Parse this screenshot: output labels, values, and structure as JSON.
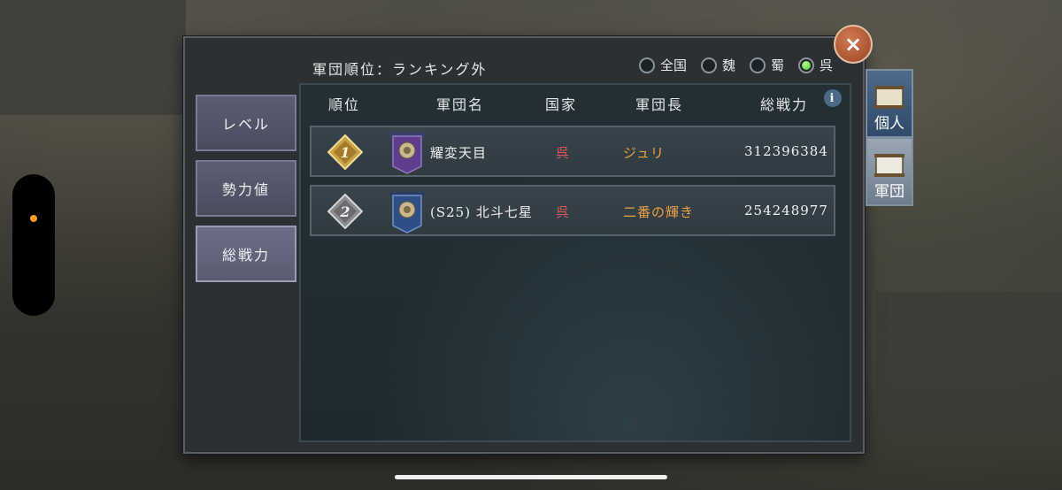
{
  "header": {
    "ranking_status": "軍団順位：ランキング外",
    "filters": [
      {
        "label": "全国",
        "selected": false
      },
      {
        "label": "魏",
        "selected": false
      },
      {
        "label": "蜀",
        "selected": false
      },
      {
        "label": "呉",
        "selected": true
      }
    ]
  },
  "left_tabs": [
    {
      "label": "レベル",
      "active": false
    },
    {
      "label": "勢力値",
      "active": false
    },
    {
      "label": "総戦力",
      "active": true
    }
  ],
  "table": {
    "columns": [
      "順位",
      "軍団名",
      "国家",
      "軍団長",
      "総戦力"
    ],
    "rows": [
      {
        "rank": "1",
        "name": "耀変天目",
        "country": "呉",
        "leader": "ジュリ",
        "power": "312396384"
      },
      {
        "rank": "2",
        "name": "(S25) 北斗七星",
        "country": "呉",
        "leader": "二番の輝き",
        "power": "254248977"
      }
    ]
  },
  "right_tabs": [
    {
      "label": "個人"
    },
    {
      "label": "軍団"
    }
  ],
  "info_label": "i",
  "close_label": "×",
  "colors": {
    "country_wu": "#e0565a",
    "leader": "#f0a040",
    "selected_radio": "#4bbd2a"
  }
}
